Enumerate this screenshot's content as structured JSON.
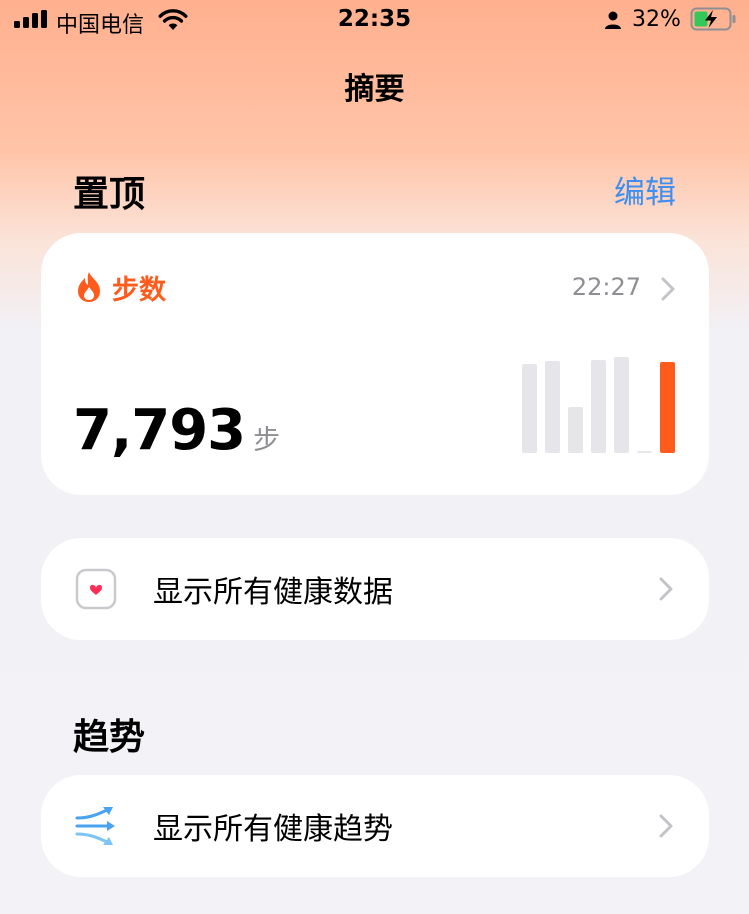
{
  "status_bar": {
    "carrier": "中国电信",
    "time": "22:35",
    "battery": "32%"
  },
  "nav": {
    "title": "摘要"
  },
  "pinned": {
    "title": "置顶",
    "edit_label": "编辑",
    "steps": {
      "label": "步数",
      "time": "22:27",
      "value": "7,793",
      "unit": "步",
      "accent": "#ff5b1c",
      "bar_levels": [
        0.89,
        0.92,
        0.46,
        0.93,
        0.96,
        0.02,
        0.91
      ],
      "highlight_index": 6
    }
  },
  "all_health_data": {
    "label": "显示所有健康数据"
  },
  "trends": {
    "title": "趋势",
    "all_trends_label": "显示所有健康趋势"
  },
  "icons": [
    "signal-icon",
    "wifi-icon",
    "person-icon",
    "battery-charging-icon",
    "flame-icon",
    "chevron-right-icon",
    "health-heart-icon",
    "trend-arrows-icon"
  ]
}
